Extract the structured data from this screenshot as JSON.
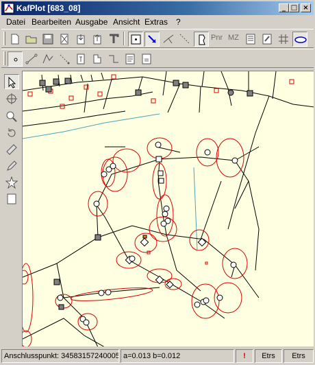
{
  "window": {
    "title": "KafPlot [683_08]"
  },
  "caption_buttons": {
    "minimize": "_",
    "maximize": "□",
    "close": "×"
  },
  "menu": [
    "Datei",
    "Bearbeiten",
    "Ausgabe",
    "Ansicht",
    "Extras",
    "?"
  ],
  "toolbar1": {
    "text_buttons": [
      "Pnr",
      "MZ"
    ]
  },
  "status": {
    "anschluss": "Anschlusspunkt: 34583157240005",
    "params": "a=0.013 b=0.012",
    "alert": "!",
    "etrs1": "Etrs",
    "etrs2": "Etrs"
  },
  "colors": {
    "canvas_bg": "#ffffe1",
    "ellipse": "#dd0000",
    "lines": "#000000",
    "aux_line": "#4aa4b8",
    "gray_square": "#808080"
  }
}
